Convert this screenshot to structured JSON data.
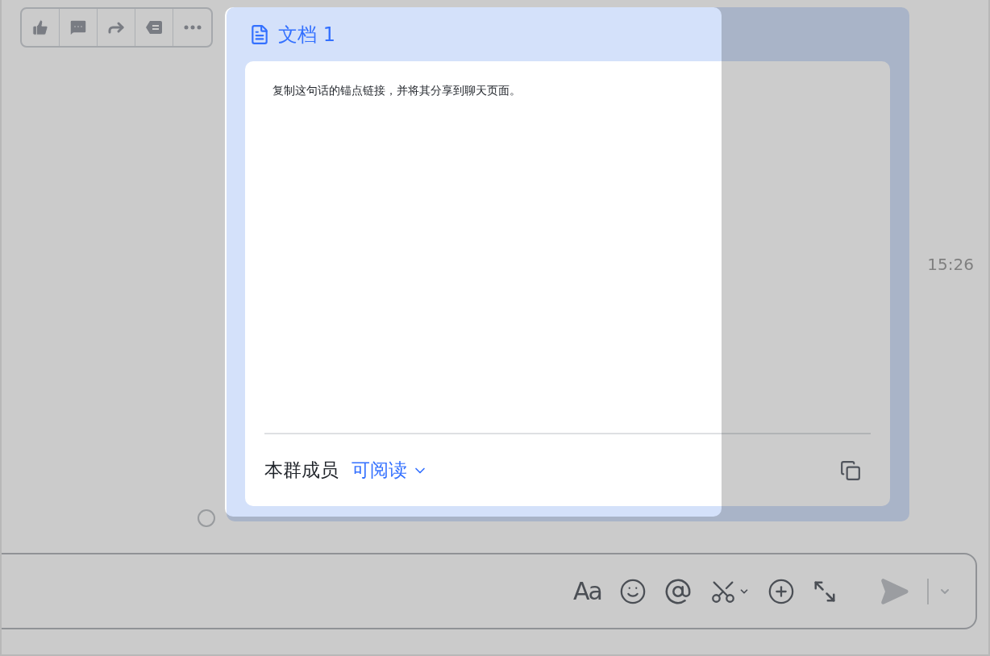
{
  "document_card": {
    "title": "文档 1",
    "content": "复制这句话的锚点链接，并将其分享到聊天页面。",
    "audience": "本群成员",
    "permission": "可阅读"
  },
  "message": {
    "selected": false,
    "timestamp": "15:26"
  },
  "composer": {
    "font_button": "Aa"
  }
}
